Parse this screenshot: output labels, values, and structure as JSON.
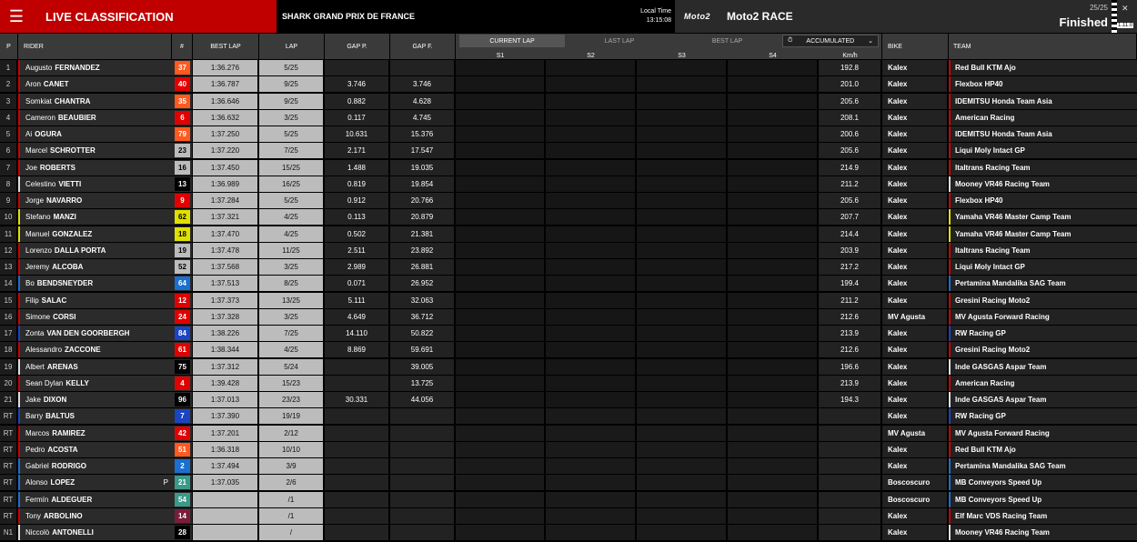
{
  "header": {
    "menu_icon": "hamburger-icon",
    "title": "LIVE CLASSIFICATION",
    "event": "SHARK GRAND PRIX DE FRANCE",
    "local_time_label": "Local Time",
    "local_time": "13:15:08",
    "series": "Moto2",
    "race": "Moto2 RACE",
    "lap_count": "25/25",
    "status": "Finished",
    "version": "1.11.0",
    "colors": {
      "red": "#c00000"
    }
  },
  "columns": {
    "pos": "P",
    "rider": "RIDER",
    "number": "#",
    "best_lap": "BEST LAP",
    "lap": "LAP",
    "gap_p": "GAP P.",
    "gap_f": "GAP F.",
    "bike": "BIKE",
    "team": "TEAM",
    "kmh": "Km/h",
    "s1": "S1",
    "s2": "S2",
    "s3": "S3",
    "s4": "S4"
  },
  "tabs": {
    "current": "CURRENT LAP",
    "last": "LAST LAP",
    "best": "BEST LAP",
    "accumulated": "ACCUMULATED"
  },
  "rows": [
    {
      "pos": "1",
      "first": "Augusto",
      "last": "FERNANDEZ",
      "num": "37",
      "numbg": "#ff5a1f",
      "best": "1:36.276",
      "lap": "5/25",
      "gp": "",
      "gf": "",
      "kmh": "192.8",
      "bike": "Kalex",
      "team": "Red Bull KTM Ajo",
      "tc": "#c00"
    },
    {
      "pos": "2",
      "first": "Aron",
      "last": "CANET",
      "num": "40",
      "numbg": "#e10000",
      "best": "1:36.787",
      "lap": "9/25",
      "gp": "3.746",
      "gf": "3.746",
      "kmh": "201.0",
      "bike": "Kalex",
      "team": "Flexbox HP40",
      "tc": "#c00"
    },
    {
      "pos": "3",
      "first": "Somkiat",
      "last": "CHANTRA",
      "num": "35",
      "numbg": "#ff5a1f",
      "best": "1:36.646",
      "lap": "9/25",
      "gp": "0.882",
      "gf": "4.628",
      "kmh": "205.6",
      "bike": "Kalex",
      "team": "IDEMITSU Honda Team Asia",
      "tc": "#c00"
    },
    {
      "pos": "4",
      "first": "Cameron",
      "last": "BEAUBIER",
      "num": "6",
      "numbg": "#e10000",
      "best": "1:36.632",
      "lap": "3/25",
      "gp": "0.117",
      "gf": "4.745",
      "kmh": "208.1",
      "bike": "Kalex",
      "team": "American Racing",
      "tc": "#c00"
    },
    {
      "pos": "5",
      "first": "Ai",
      "last": "OGURA",
      "num": "79",
      "numbg": "#ff5a1f",
      "best": "1:37.250",
      "lap": "5/25",
      "gp": "10.631",
      "gf": "15.376",
      "kmh": "200.6",
      "bike": "Kalex",
      "team": "IDEMITSU Honda Team Asia",
      "tc": "#c00"
    },
    {
      "pos": "6",
      "first": "Marcel",
      "last": "SCHROTTER",
      "num": "23",
      "numbg": "#bcbcbc",
      "best": "1:37.220",
      "lap": "7/25",
      "gp": "2.171",
      "gf": "17.547",
      "kmh": "205.6",
      "bike": "Kalex",
      "team": "Liqui Moly Intact GP",
      "tc": "#c00"
    },
    {
      "pos": "7",
      "first": "Joe",
      "last": "ROBERTS",
      "num": "16",
      "numbg": "#bcbcbc",
      "best": "1:37.450",
      "lap": "15/25",
      "gp": "1.488",
      "gf": "19.035",
      "kmh": "214.9",
      "bike": "Kalex",
      "team": "Italtrans Racing Team",
      "tc": "#c00"
    },
    {
      "pos": "8",
      "first": "Celestino",
      "last": "VIETTI",
      "num": "13",
      "numbg": "#000",
      "best": "1:36.989",
      "lap": "16/25",
      "gp": "0.819",
      "gf": "19.854",
      "kmh": "211.2",
      "bike": "Kalex",
      "team": "Mooney VR46 Racing Team",
      "tc": "#ddd"
    },
    {
      "pos": "9",
      "first": "Jorge",
      "last": "NAVARRO",
      "num": "9",
      "numbg": "#e10000",
      "best": "1:37.284",
      "lap": "5/25",
      "gp": "0.912",
      "gf": "20.766",
      "kmh": "205.6",
      "bike": "Kalex",
      "team": "Flexbox HP40",
      "tc": "#c00"
    },
    {
      "pos": "10",
      "first": "Stefano",
      "last": "MANZI",
      "num": "62",
      "numbg": "#e0e000",
      "best": "1:37.321",
      "lap": "4/25",
      "gp": "0.113",
      "gf": "20.879",
      "kmh": "207.7",
      "bike": "Kalex",
      "team": "Yamaha VR46 Master Camp Team",
      "tc": "#e0e000"
    },
    {
      "pos": "11",
      "first": "Manuel",
      "last": "GONZALEZ",
      "num": "18",
      "numbg": "#e0e000",
      "best": "1:37.470",
      "lap": "4/25",
      "gp": "0.502",
      "gf": "21.381",
      "kmh": "214.4",
      "bike": "Kalex",
      "team": "Yamaha VR46 Master Camp Team",
      "tc": "#e0e000"
    },
    {
      "pos": "12",
      "first": "Lorenzo",
      "last": "DALLA PORTA",
      "num": "19",
      "numbg": "#bcbcbc",
      "best": "1:37.478",
      "lap": "11/25",
      "gp": "2.511",
      "gf": "23.892",
      "kmh": "203.9",
      "bike": "Kalex",
      "team": "Italtrans Racing Team",
      "tc": "#c00"
    },
    {
      "pos": "13",
      "first": "Jeremy",
      "last": "ALCOBA",
      "num": "52",
      "numbg": "#bcbcbc",
      "best": "1:37.568",
      "lap": "3/25",
      "gp": "2.989",
      "gf": "26.881",
      "kmh": "217.2",
      "bike": "Kalex",
      "team": "Liqui Moly Intact GP",
      "tc": "#c00"
    },
    {
      "pos": "14",
      "first": "Bo",
      "last": "BENDSNEYDER",
      "num": "64",
      "numbg": "#1a6fd0",
      "best": "1:37.513",
      "lap": "8/25",
      "gp": "0.071",
      "gf": "26.952",
      "kmh": "199.4",
      "bike": "Kalex",
      "team": "Pertamina Mandalika SAG Team",
      "tc": "#1a6fd0"
    },
    {
      "pos": "15",
      "first": "Filip",
      "last": "SALAC",
      "num": "12",
      "numbg": "#e10000",
      "best": "1:37.373",
      "lap": "13/25",
      "gp": "5.111",
      "gf": "32.063",
      "kmh": "211.2",
      "bike": "Kalex",
      "team": "Gresini Racing Moto2",
      "tc": "#c00"
    },
    {
      "pos": "16",
      "first": "Simone",
      "last": "CORSI",
      "num": "24",
      "numbg": "#e10000",
      "best": "1:37.328",
      "lap": "3/25",
      "gp": "4.649",
      "gf": "36.712",
      "kmh": "212.6",
      "bike": "MV Agusta",
      "team": "MV Agusta Forward Racing",
      "tc": "#c00"
    },
    {
      "pos": "17",
      "first": "Zonta",
      "last": "VAN DEN GOORBERGH",
      "num": "84",
      "numbg": "#1a44c0",
      "best": "1:38.226",
      "lap": "7/25",
      "gp": "14.110",
      "gf": "50.822",
      "kmh": "213.9",
      "bike": "Kalex",
      "team": "RW Racing GP",
      "tc": "#1a44c0"
    },
    {
      "pos": "18",
      "first": "Alessandro",
      "last": "ZACCONE",
      "num": "61",
      "numbg": "#e10000",
      "best": "1:38.344",
      "lap": "4/25",
      "gp": "8.869",
      "gf": "59.691",
      "kmh": "212.6",
      "bike": "Kalex",
      "team": "Gresini Racing Moto2",
      "tc": "#c00"
    },
    {
      "pos": "19",
      "first": "Albert",
      "last": "ARENAS",
      "num": "75",
      "numbg": "#000",
      "best": "1:37.312",
      "lap": "5/24",
      "gp": "",
      "gf": "39.005",
      "kmh": "196.6",
      "bike": "Kalex",
      "team": "Inde GASGAS Aspar Team",
      "tc": "#ddd"
    },
    {
      "pos": "20",
      "first": "Sean Dylan",
      "last": "KELLY",
      "num": "4",
      "numbg": "#e10000",
      "best": "1:39.428",
      "lap": "15/23",
      "gp": "",
      "gf": "13.725",
      "kmh": "213.9",
      "bike": "Kalex",
      "team": "American Racing",
      "tc": "#c00"
    },
    {
      "pos": "21",
      "first": "Jake",
      "last": "DIXON",
      "num": "96",
      "numbg": "#000",
      "best": "1:37.013",
      "lap": "23/23",
      "gp": "30.331",
      "gf": "44.056",
      "kmh": "194.3",
      "bike": "Kalex",
      "team": "Inde GASGAS Aspar Team",
      "tc": "#ddd"
    },
    {
      "pos": "RT",
      "first": "Barry",
      "last": "BALTUS",
      "num": "7",
      "numbg": "#1a44c0",
      "best": "1:37.390",
      "lap": "19/19",
      "gp": "",
      "gf": "",
      "kmh": "",
      "bike": "Kalex",
      "team": "RW Racing GP",
      "tc": "#1a44c0"
    },
    {
      "pos": "RT",
      "first": "Marcos",
      "last": "RAMIREZ",
      "num": "42",
      "numbg": "#e10000",
      "best": "1:37.201",
      "lap": "2/12",
      "gp": "",
      "gf": "",
      "kmh": "",
      "bike": "MV Agusta",
      "team": "MV Agusta Forward Racing",
      "tc": "#c00"
    },
    {
      "pos": "RT",
      "first": "Pedro",
      "last": "ACOSTA",
      "num": "51",
      "numbg": "#ff5a1f",
      "best": "1:36.318",
      "lap": "10/10",
      "gp": "",
      "gf": "",
      "kmh": "",
      "bike": "Kalex",
      "team": "Red Bull KTM Ajo",
      "tc": "#c00"
    },
    {
      "pos": "RT",
      "first": "Gabriel",
      "last": "RODRIGO",
      "num": "2",
      "numbg": "#1a6fd0",
      "best": "1:37.494",
      "lap": "3/9",
      "gp": "",
      "gf": "",
      "kmh": "",
      "bike": "Kalex",
      "team": "Pertamina Mandalika SAG Team",
      "tc": "#1a6fd0"
    },
    {
      "pos": "RT",
      "first": "Alonso",
      "last": "LOPEZ",
      "num": "21",
      "numbg": "#3a9a8a",
      "best": "1:37.035",
      "lap": "2/6",
      "gp": "",
      "gf": "",
      "kmh": "",
      "bike": "Boscoscuro",
      "team": "MB Conveyors Speed Up",
      "tc": "#1a6fd0",
      "penalty": "P"
    },
    {
      "pos": "RT",
      "first": "Fermín",
      "last": "ALDEGUER",
      "num": "54",
      "numbg": "#3a9a8a",
      "best": "",
      "lap": "/1",
      "gp": "",
      "gf": "",
      "kmh": "",
      "bike": "Boscoscuro",
      "team": "MB Conveyors Speed Up",
      "tc": "#1a6fd0"
    },
    {
      "pos": "RT",
      "first": "Tony",
      "last": "ARBOLINO",
      "num": "14",
      "numbg": "#7a1d3a",
      "best": "",
      "lap": "/1",
      "gp": "",
      "gf": "",
      "kmh": "",
      "bike": "Kalex",
      "team": "Elf Marc VDS Racing Team",
      "tc": "#c00"
    },
    {
      "pos": "N1",
      "first": "Niccolò",
      "last": "ANTONELLI",
      "num": "28",
      "numbg": "#000",
      "best": "",
      "lap": "/",
      "gp": "",
      "gf": "",
      "kmh": "",
      "bike": "Kalex",
      "team": "Mooney VR46 Racing Team",
      "tc": "#ddd"
    }
  ]
}
